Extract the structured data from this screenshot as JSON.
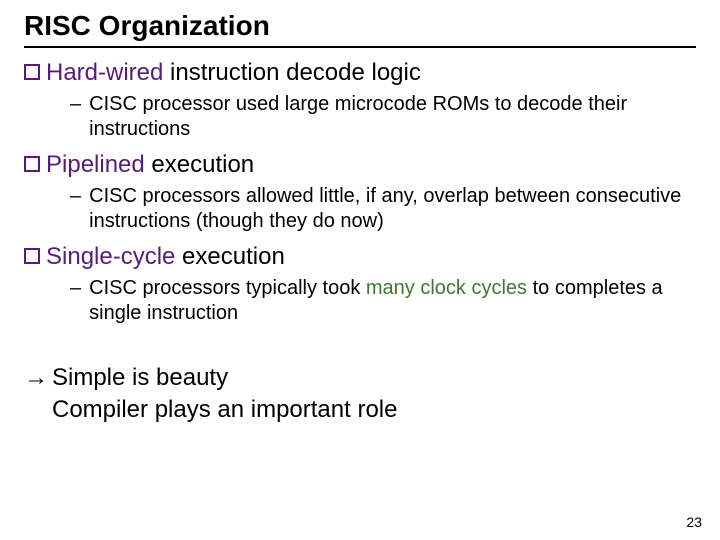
{
  "title": "RISC Organization",
  "items": [
    {
      "head_purple": "Hard-wired",
      "head_rest": " instruction decode logic",
      "sub_pre": "CISC processor used large microcode ROMs to decode their instructions",
      "sub_green": "",
      "sub_post": ""
    },
    {
      "head_purple": "Pipelined",
      "head_rest": " execution",
      "sub_pre": "CISC processors allowed little, if any, overlap between consecutive instructions (though they do now)",
      "sub_green": "",
      "sub_post": ""
    },
    {
      "head_purple": "Single-cycle",
      "head_rest": " execution",
      "sub_pre": "CISC processors typically took ",
      "sub_green": "many clock cycles",
      "sub_post": " to completes a single instruction"
    }
  ],
  "closing": {
    "arrow": "→",
    "line1": "Simple is beauty",
    "line2": "Compiler plays an important role"
  },
  "page_number": "23"
}
